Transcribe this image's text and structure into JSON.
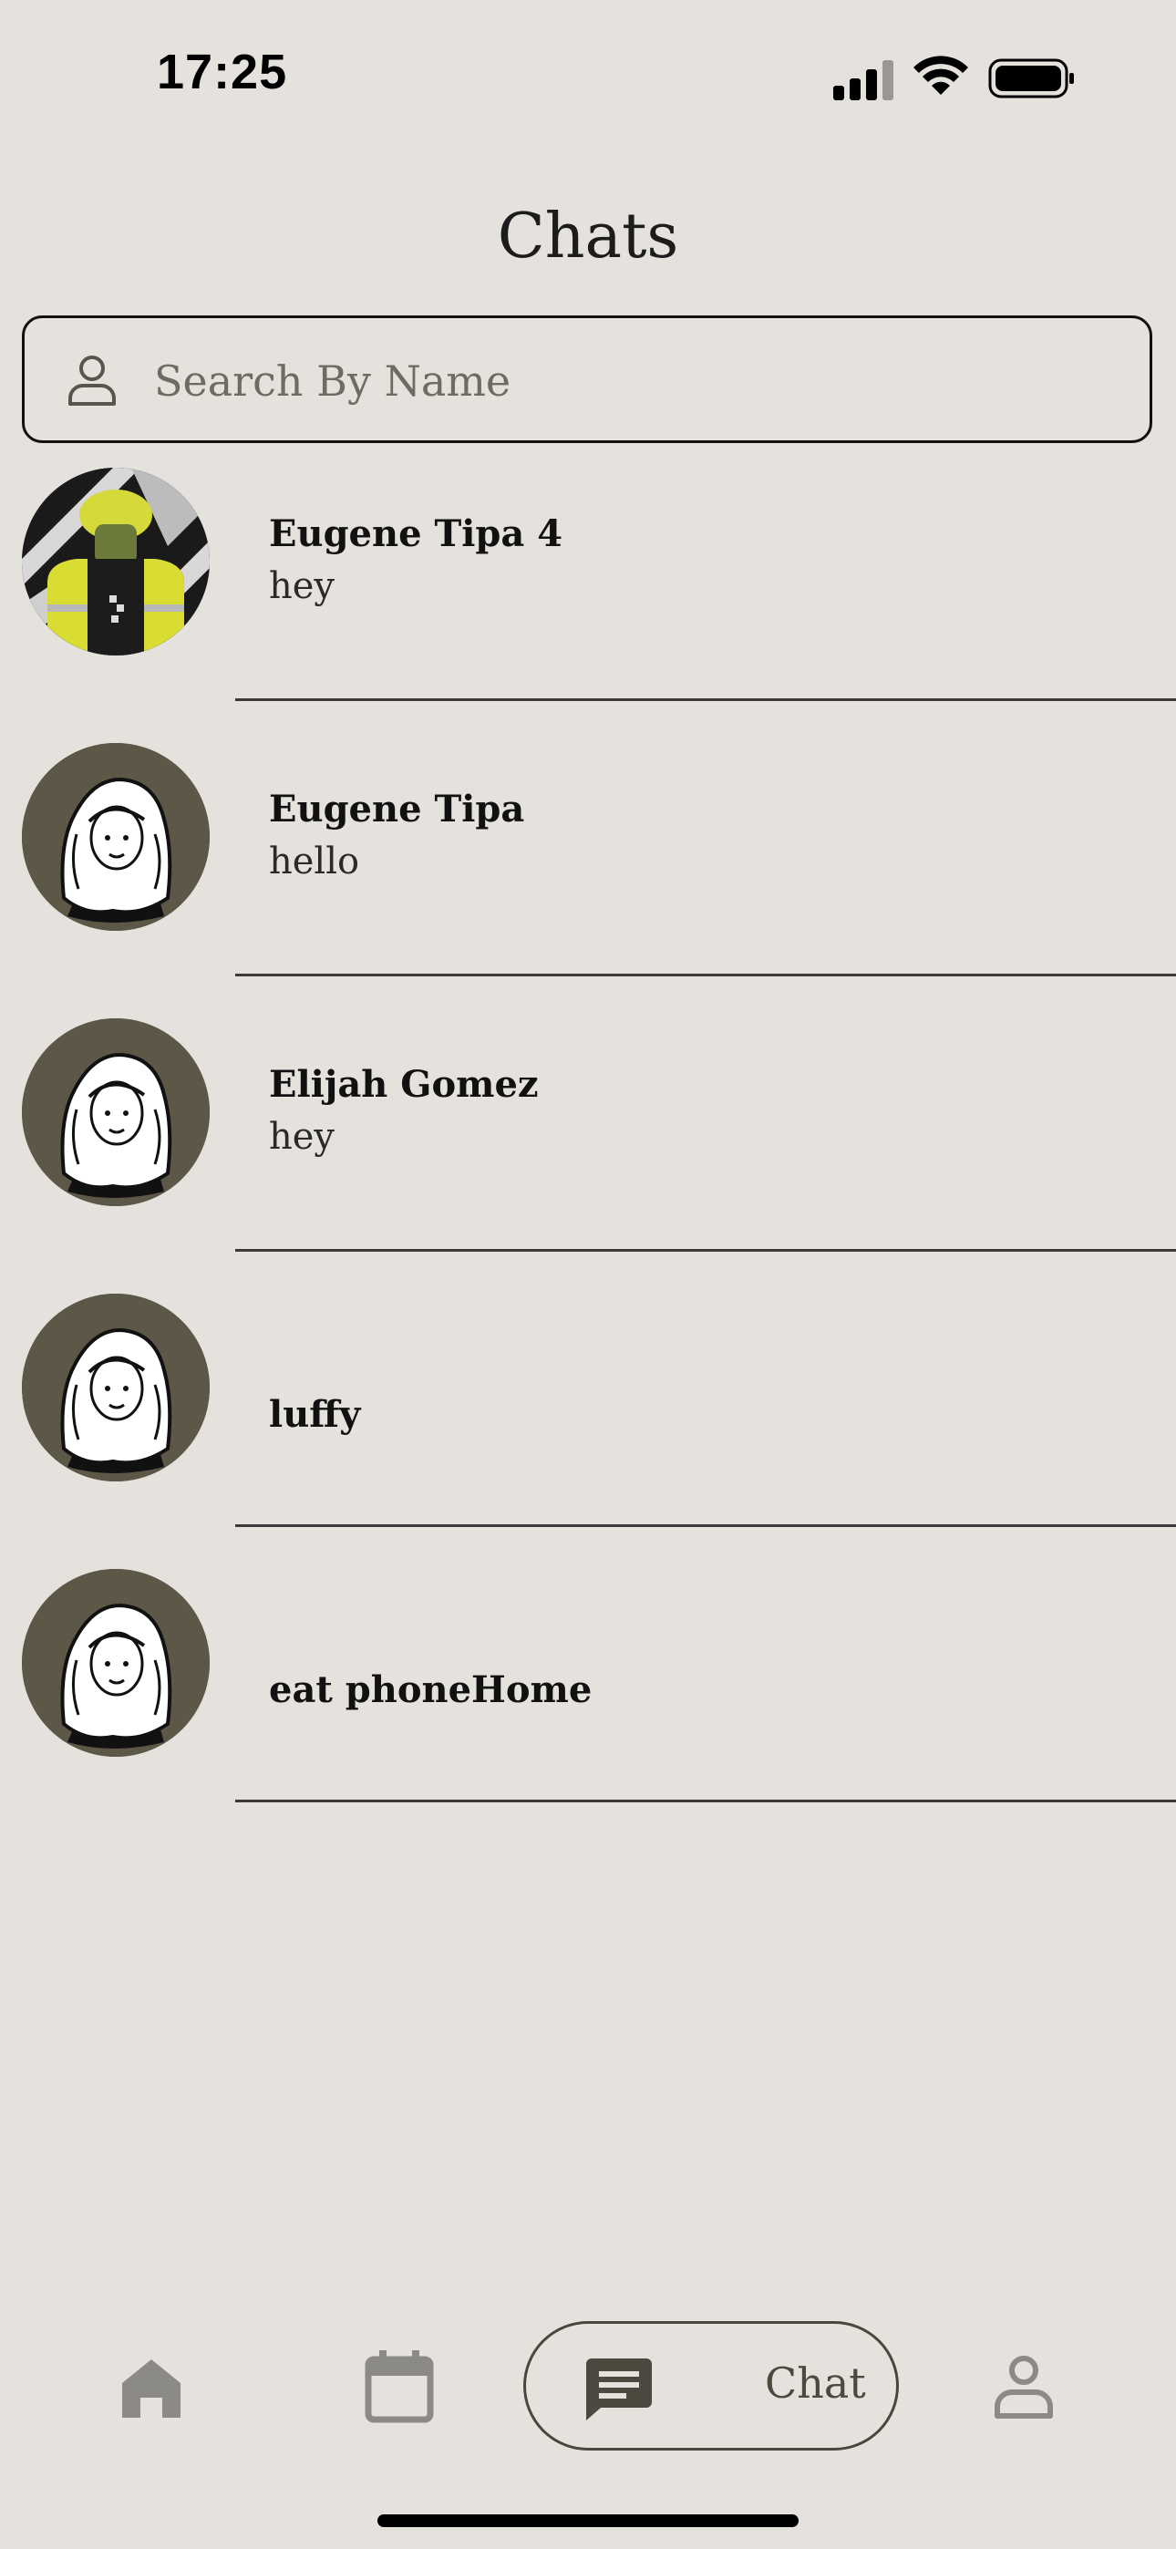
{
  "status_bar": {
    "time": "17:25",
    "icons": [
      "cellular-signal-icon",
      "wifi-icon",
      "battery-icon"
    ]
  },
  "header": {
    "title": "Chats"
  },
  "search": {
    "placeholder": "Search By Name",
    "value": "",
    "icon": "person-outline-icon"
  },
  "chats": [
    {
      "name": "Eugene Tipa 4",
      "preview": "hey",
      "avatar": "photo-avatar"
    },
    {
      "name": "Eugene Tipa",
      "preview": "hello",
      "avatar": "illustrated-avatar"
    },
    {
      "name": "Elijah Gomez",
      "preview": "hey",
      "avatar": "illustrated-avatar"
    },
    {
      "name": "luffy",
      "preview": "",
      "avatar": "illustrated-avatar"
    },
    {
      "name": "eat phoneHome",
      "preview": "",
      "avatar": "illustrated-avatar"
    }
  ],
  "tabbar": {
    "items": [
      {
        "icon": "home-icon",
        "label": ""
      },
      {
        "icon": "calendar-icon",
        "label": ""
      },
      {
        "icon": "chat-bubble-icon",
        "label": "Chat",
        "active": true
      },
      {
        "icon": "profile-icon",
        "label": ""
      }
    ]
  },
  "colors": {
    "background": "#e5e2de",
    "avatar_background": "#5d5748",
    "active_tab": "#4d493f",
    "inactive_tab": "#8c8a86"
  }
}
